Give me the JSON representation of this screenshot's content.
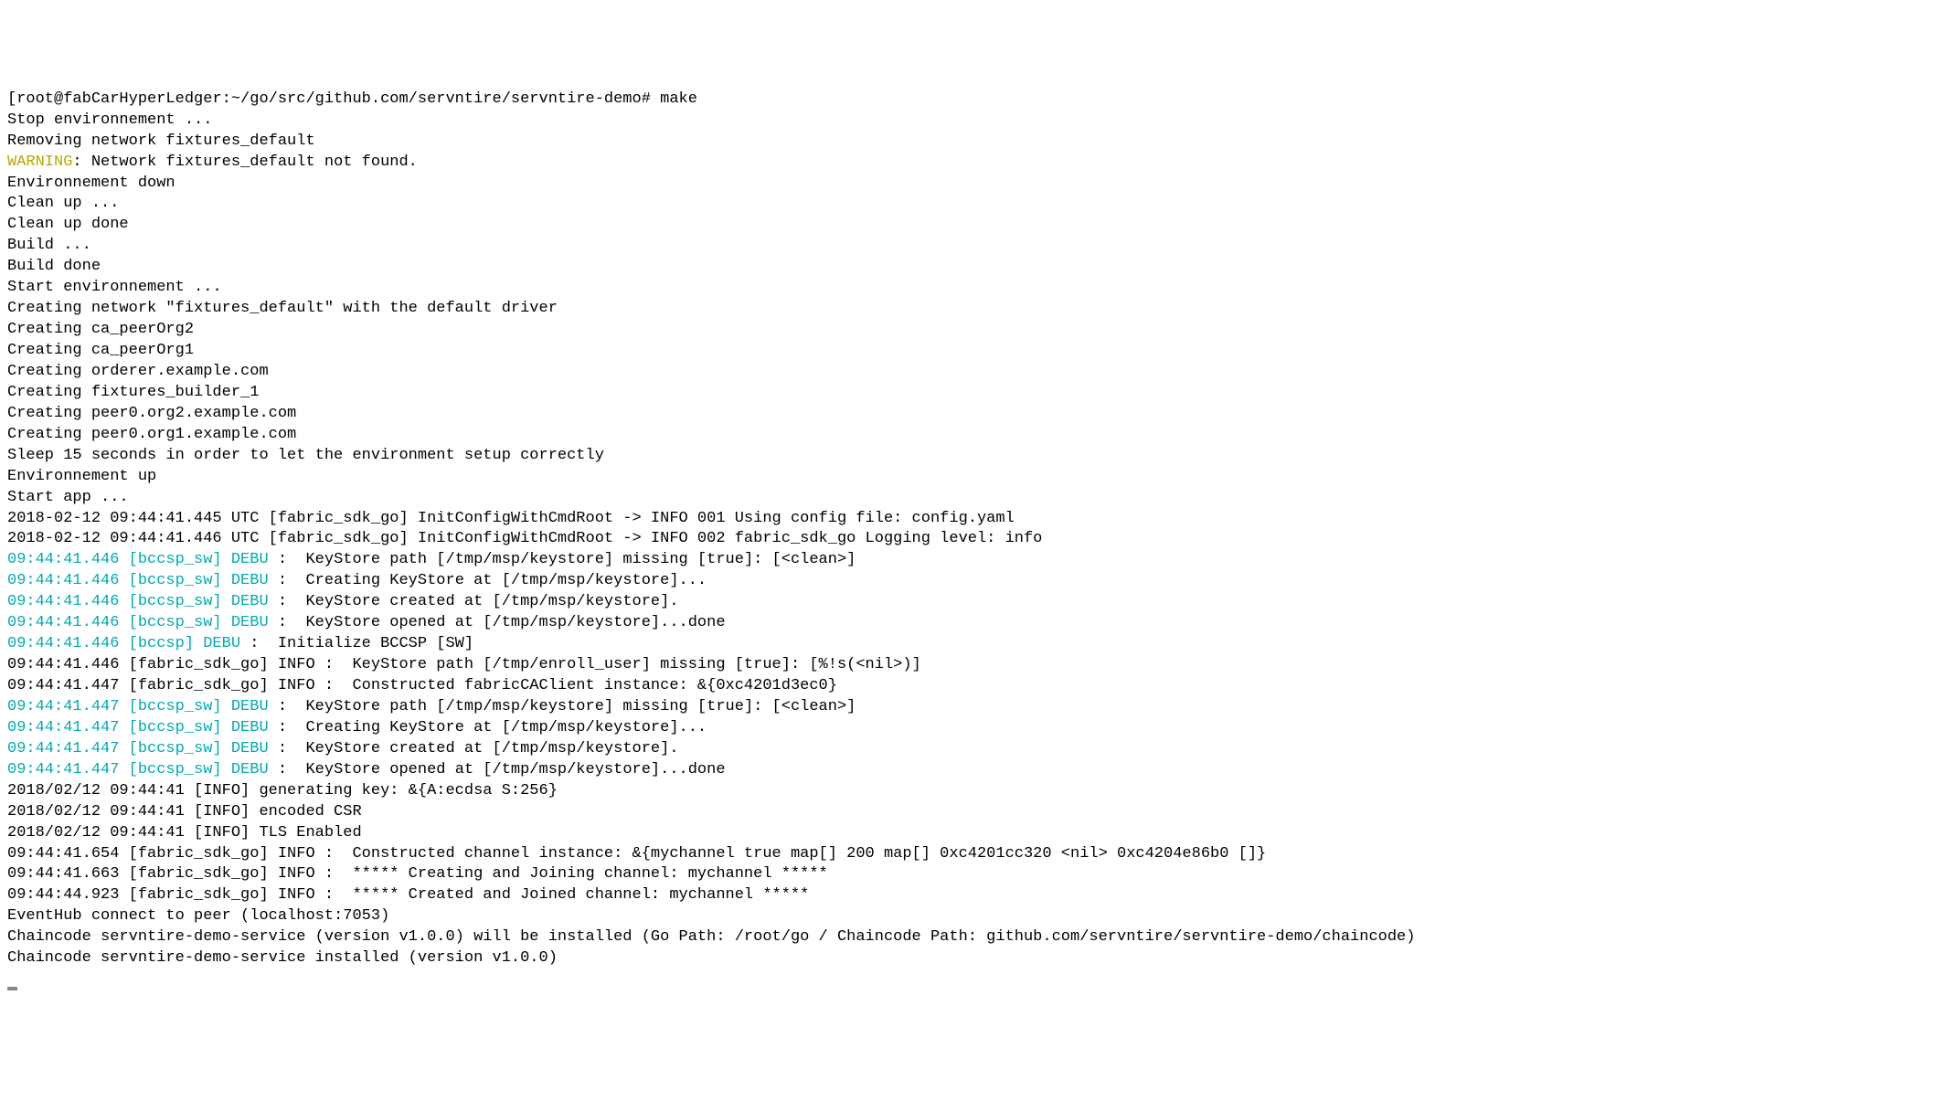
{
  "prompt": {
    "bracket_open": "[",
    "user_host_path": "root@fabCarHyperLedger:~/go/src/github.com/servntire/servntire-demo#",
    "command": " make"
  },
  "lines": [
    {
      "segments": [
        {
          "text": "Stop environnement ..."
        }
      ]
    },
    {
      "segments": [
        {
          "text": "Removing network fixtures_default"
        }
      ]
    },
    {
      "segments": [
        {
          "text": "WARNING",
          "cls": "warning"
        },
        {
          "text": ": Network fixtures_default not found."
        }
      ]
    },
    {
      "segments": [
        {
          "text": "Environnement down"
        }
      ]
    },
    {
      "segments": [
        {
          "text": "Clean up ..."
        }
      ]
    },
    {
      "segments": [
        {
          "text": "Clean up done"
        }
      ]
    },
    {
      "segments": [
        {
          "text": "Build ..."
        }
      ]
    },
    {
      "segments": [
        {
          "text": "Build done"
        }
      ]
    },
    {
      "segments": [
        {
          "text": "Start environnement ..."
        }
      ]
    },
    {
      "segments": [
        {
          "text": "Creating network \"fixtures_default\" with the default driver"
        }
      ]
    },
    {
      "segments": [
        {
          "text": "Creating ca_peerOrg2"
        }
      ]
    },
    {
      "segments": [
        {
          "text": "Creating ca_peerOrg1"
        }
      ]
    },
    {
      "segments": [
        {
          "text": "Creating orderer.example.com"
        }
      ]
    },
    {
      "segments": [
        {
          "text": "Creating fixtures_builder_1"
        }
      ]
    },
    {
      "segments": [
        {
          "text": "Creating peer0.org2.example.com"
        }
      ]
    },
    {
      "segments": [
        {
          "text": "Creating peer0.org1.example.com"
        }
      ]
    },
    {
      "segments": [
        {
          "text": "Sleep 15 seconds in order to let the environment setup correctly"
        }
      ]
    },
    {
      "segments": [
        {
          "text": "Environnement up"
        }
      ]
    },
    {
      "segments": [
        {
          "text": "Start app ..."
        }
      ]
    },
    {
      "segments": [
        {
          "text": "2018-02-12 09:44:41.445 UTC [fabric_sdk_go] InitConfigWithCmdRoot -> INFO 001 Using config file: config.yaml"
        }
      ]
    },
    {
      "segments": [
        {
          "text": "2018-02-12 09:44:41.446 UTC [fabric_sdk_go] InitConfigWithCmdRoot -> INFO 002 fabric_sdk_go Logging level: info"
        }
      ]
    },
    {
      "segments": [
        {
          "text": "09:44:41.446 [bccsp_sw] DEBU",
          "cls": "cyan"
        },
        {
          "text": " :  KeyStore path [/tmp/msp/keystore] missing [true]: [<clean>]"
        }
      ]
    },
    {
      "segments": [
        {
          "text": "09:44:41.446 [bccsp_sw] DEBU",
          "cls": "cyan"
        },
        {
          "text": " :  Creating KeyStore at [/tmp/msp/keystore]..."
        }
      ]
    },
    {
      "segments": [
        {
          "text": "09:44:41.446 [bccsp_sw] DEBU",
          "cls": "cyan"
        },
        {
          "text": " :  KeyStore created at [/tmp/msp/keystore]."
        }
      ]
    },
    {
      "segments": [
        {
          "text": "09:44:41.446 [bccsp_sw] DEBU",
          "cls": "cyan"
        },
        {
          "text": " :  KeyStore opened at [/tmp/msp/keystore]...done"
        }
      ]
    },
    {
      "segments": [
        {
          "text": "09:44:41.446 [bccsp] DEBU",
          "cls": "cyan"
        },
        {
          "text": " :  Initialize BCCSP [SW]"
        }
      ]
    },
    {
      "segments": [
        {
          "text": "09:44:41.446 [fabric_sdk_go] INFO :  KeyStore path [/tmp/enroll_user] missing [true]: [%!s(<nil>)]"
        }
      ]
    },
    {
      "segments": [
        {
          "text": "09:44:41.447 [fabric_sdk_go] INFO :  Constructed fabricCAClient instance: &{0xc4201d3ec0}"
        }
      ]
    },
    {
      "segments": [
        {
          "text": "09:44:41.447 [bccsp_sw] DEBU",
          "cls": "cyan"
        },
        {
          "text": " :  KeyStore path [/tmp/msp/keystore] missing [true]: [<clean>]"
        }
      ]
    },
    {
      "segments": [
        {
          "text": "09:44:41.447 [bccsp_sw] DEBU",
          "cls": "cyan"
        },
        {
          "text": " :  Creating KeyStore at [/tmp/msp/keystore]..."
        }
      ]
    },
    {
      "segments": [
        {
          "text": "09:44:41.447 [bccsp_sw] DEBU",
          "cls": "cyan"
        },
        {
          "text": " :  KeyStore created at [/tmp/msp/keystore]."
        }
      ]
    },
    {
      "segments": [
        {
          "text": "09:44:41.447 [bccsp_sw] DEBU",
          "cls": "cyan"
        },
        {
          "text": " :  KeyStore opened at [/tmp/msp/keystore]...done"
        }
      ]
    },
    {
      "segments": [
        {
          "text": "2018/02/12 09:44:41 [INFO] generating key: &{A:ecdsa S:256}"
        }
      ]
    },
    {
      "segments": [
        {
          "text": "2018/02/12 09:44:41 [INFO] encoded CSR"
        }
      ]
    },
    {
      "segments": [
        {
          "text": "2018/02/12 09:44:41 [INFO] TLS Enabled"
        }
      ]
    },
    {
      "segments": [
        {
          "text": "09:44:41.654 [fabric_sdk_go] INFO :  Constructed channel instance: &{mychannel true map[] 200 map[] 0xc4201cc320 <nil> 0xc4204e86b0 []}"
        }
      ]
    },
    {
      "segments": [
        {
          "text": "09:44:41.663 [fabric_sdk_go] INFO :  ***** Creating and Joining channel: mychannel *****"
        }
      ]
    },
    {
      "segments": [
        {
          "text": "09:44:44.923 [fabric_sdk_go] INFO :  ***** Created and Joined channel: mychannel *****"
        }
      ]
    },
    {
      "segments": [
        {
          "text": "EventHub connect to peer (localhost:7053)"
        }
      ]
    },
    {
      "segments": [
        {
          "text": "Chaincode servntire-demo-service (version v1.0.0) will be installed (Go Path: /root/go / Chaincode Path: github.com/servntire/servntire-demo/chaincode)"
        }
      ]
    },
    {
      "segments": [
        {
          "text": "Chaincode servntire-demo-service installed (version v1.0.0)"
        }
      ]
    }
  ]
}
